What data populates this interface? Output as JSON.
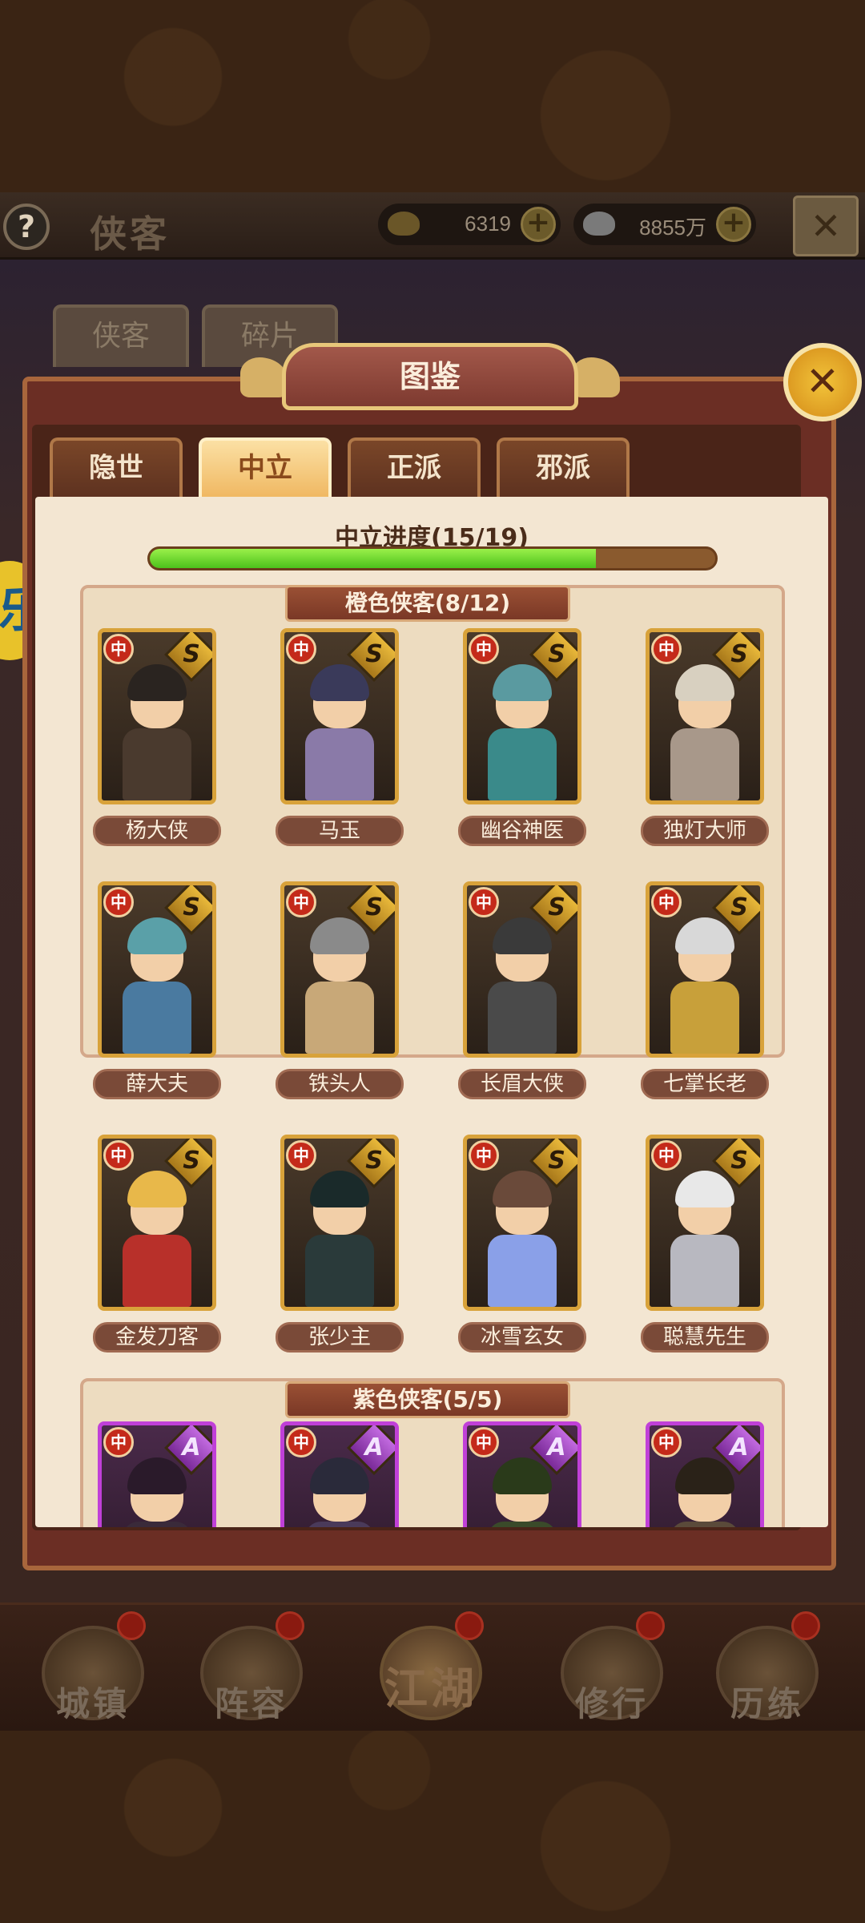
{
  "header": {
    "title": "侠客",
    "help_label": "?",
    "close_label": "✕",
    "currencies": [
      {
        "name": "gold-ingot",
        "value": "6319",
        "add_label": "+"
      },
      {
        "name": "silver-ingot",
        "value": "8855万",
        "add_label": "+"
      }
    ]
  },
  "outer_tabs": [
    "侠客",
    "碎片"
  ],
  "panel": {
    "title": "图鉴",
    "close_label": "✕",
    "tabs": [
      {
        "label": "隐世",
        "active": false
      },
      {
        "label": "中立",
        "active": true
      },
      {
        "label": "正派",
        "active": false
      },
      {
        "label": "邪派",
        "active": false
      }
    ],
    "progress": {
      "label": "中立进度(15/19)",
      "current": 15,
      "total": 19
    }
  },
  "sections": [
    {
      "label": "橙色侠客(8/12)",
      "grade": "S",
      "heroes": [
        {
          "name": "杨大侠",
          "faction": "中",
          "hair": "#2a2420",
          "robe": "#4a3a2e"
        },
        {
          "name": "马玉",
          "faction": "中",
          "hair": "#3a3a5a",
          "robe": "#8a7aa8"
        },
        {
          "name": "幽谷神医",
          "faction": "中",
          "hair": "#5a9aa0",
          "robe": "#3a8a8a"
        },
        {
          "name": "独灯大师",
          "faction": "中",
          "hair": "#d8d0c0",
          "robe": "#a8988a"
        },
        {
          "name": "薛大夫",
          "faction": "中",
          "hair": "#5aa0a8",
          "robe": "#4a7aa0"
        },
        {
          "name": "铁头人",
          "faction": "中",
          "hair": "#8a8a8a",
          "robe": "#c8a878"
        },
        {
          "name": "长眉大侠",
          "faction": "中",
          "hair": "#3a3a3a",
          "robe": "#4a4a4a"
        },
        {
          "name": "七掌长老",
          "faction": "中",
          "hair": "#d8d8d8",
          "robe": "#c8a03a"
        },
        {
          "name": "金发刀客",
          "faction": "中",
          "hair": "#e8b84a",
          "robe": "#b8302a"
        },
        {
          "name": "张少主",
          "faction": "中",
          "hair": "#1a2a2a",
          "robe": "#2a3a3a"
        },
        {
          "name": "冰雪玄女",
          "faction": "中",
          "hair": "#6a4a3a",
          "robe": "#8aa0e8"
        },
        {
          "name": "聪慧先生",
          "faction": "中",
          "hair": "#e8e8e8",
          "robe": "#b8b8c0"
        }
      ]
    },
    {
      "label": "紫色侠客(5/5)",
      "grade": "A",
      "heroes": [
        {
          "name": "",
          "faction": "中",
          "hair": "#2a1a2a",
          "robe": "#3a2a3a"
        },
        {
          "name": "",
          "faction": "中",
          "hair": "#2a2a3a",
          "robe": "#4a3a5a"
        },
        {
          "name": "",
          "faction": "中",
          "hair": "#2a3a1a",
          "robe": "#3a4a2a"
        },
        {
          "name": "",
          "faction": "中",
          "hair": "#2a2218",
          "robe": "#5a4a3a"
        }
      ]
    }
  ],
  "bottom_nav": [
    {
      "label": "城镇",
      "icon": "town-icon"
    },
    {
      "label": "阵容",
      "icon": "lineup-icon"
    },
    {
      "label": "江湖",
      "icon": "jianghu-icon"
    },
    {
      "label": "修行",
      "icon": "training-icon"
    },
    {
      "label": "历练",
      "icon": "experience-icon"
    }
  ],
  "side_button": {
    "label": "乐"
  },
  "colors": {
    "orange_frame": "#d8a23a",
    "purple_frame": "#c040d8",
    "progress_fill": "#4cc21c",
    "accent_gold": "#f2c43a"
  }
}
